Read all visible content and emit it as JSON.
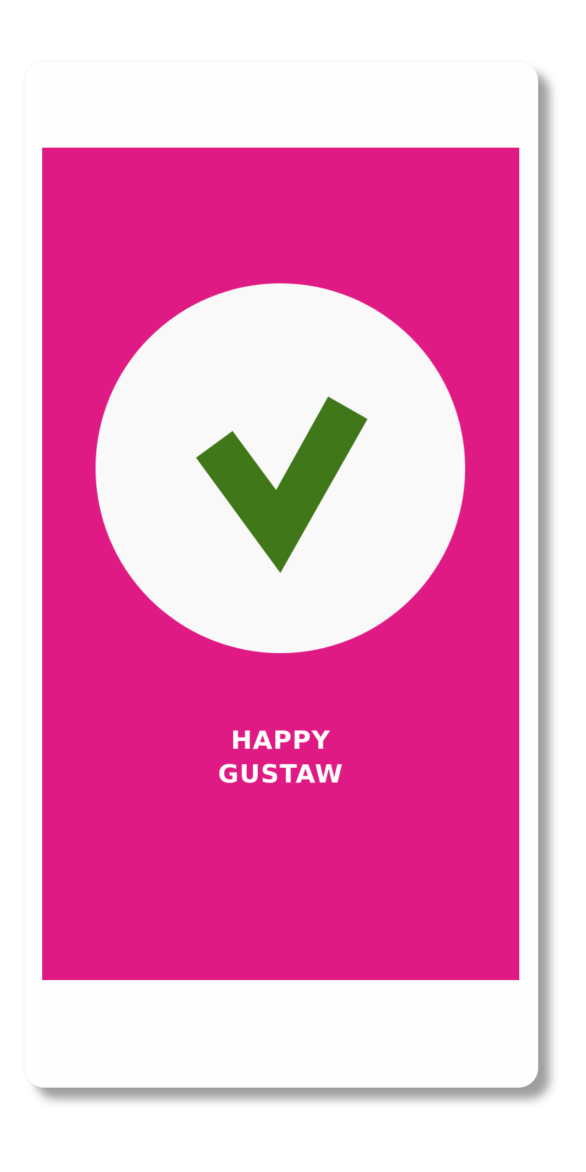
{
  "screen": {
    "background_color": "#e01a84",
    "badge_color": "#f9f9f9",
    "check_color": "#407718",
    "icon": "checkmark-icon",
    "message_line1": "HAPPY",
    "message_line2": "GUSTAW"
  }
}
